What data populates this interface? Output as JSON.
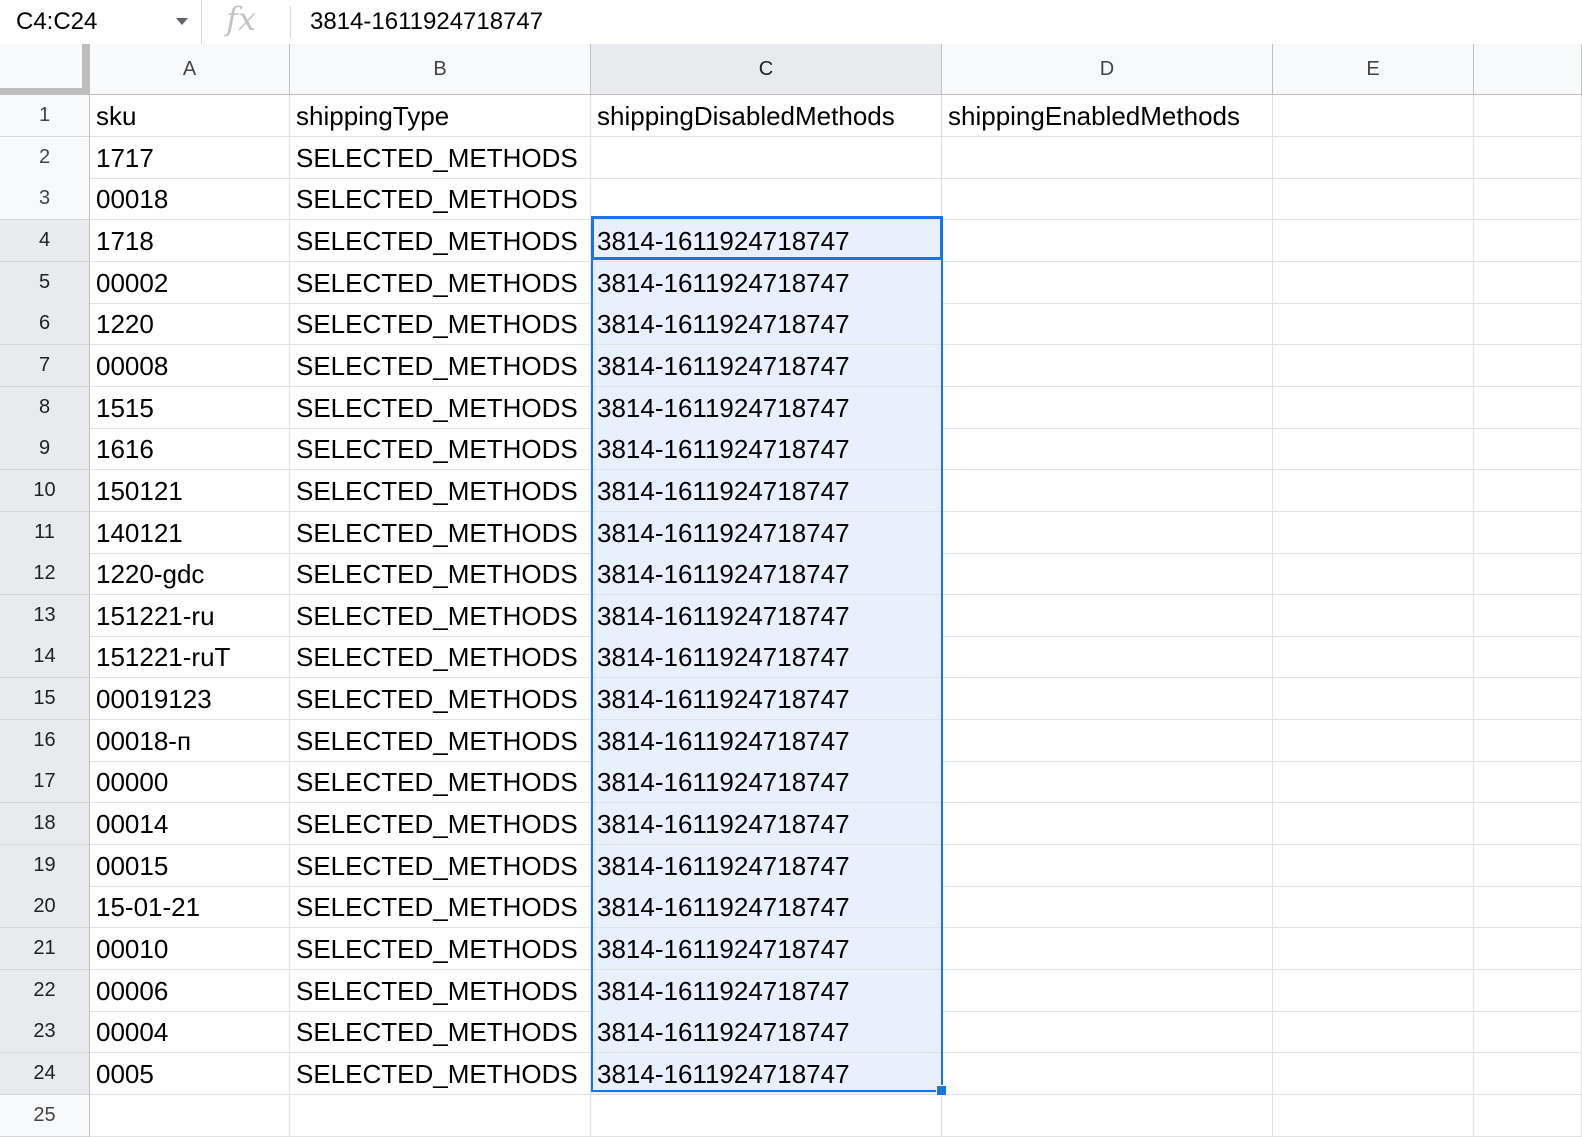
{
  "formula_bar": {
    "name_box": "C4:C24",
    "fx_icon": "fx-icon",
    "formula": "3814-1611924718747"
  },
  "columns": [
    "A",
    "B",
    "C",
    "D",
    "E"
  ],
  "selected_column": "C",
  "selected_range": "C4:C24",
  "colors": {
    "selection": "#1a73e8",
    "selection_fill": "#e8f0fe"
  },
  "rows": [
    {
      "n": "1",
      "cells": [
        "sku",
        "shippingType",
        "shippingDisabledMethods",
        "shippingEnabledMethods",
        ""
      ]
    },
    {
      "n": "2",
      "cells": [
        "1717",
        "SELECTED_METHODS",
        "",
        "",
        ""
      ]
    },
    {
      "n": "3",
      "cells": [
        "00018",
        "SELECTED_METHODS",
        "",
        "",
        ""
      ]
    },
    {
      "n": "4",
      "cells": [
        "1718",
        "SELECTED_METHODS",
        "3814-1611924718747",
        "",
        ""
      ]
    },
    {
      "n": "5",
      "cells": [
        "00002",
        "SELECTED_METHODS",
        "3814-1611924718747",
        "",
        ""
      ]
    },
    {
      "n": "6",
      "cells": [
        "1220",
        "SELECTED_METHODS",
        "3814-1611924718747",
        "",
        ""
      ]
    },
    {
      "n": "7",
      "cells": [
        "00008",
        "SELECTED_METHODS",
        "3814-1611924718747",
        "",
        ""
      ]
    },
    {
      "n": "8",
      "cells": [
        "1515",
        "SELECTED_METHODS",
        "3814-1611924718747",
        "",
        ""
      ]
    },
    {
      "n": "9",
      "cells": [
        "1616",
        "SELECTED_METHODS",
        "3814-1611924718747",
        "",
        ""
      ]
    },
    {
      "n": "10",
      "cells": [
        "150121",
        "SELECTED_METHODS",
        "3814-1611924718747",
        "",
        ""
      ]
    },
    {
      "n": "11",
      "cells": [
        "140121",
        "SELECTED_METHODS",
        "3814-1611924718747",
        "",
        ""
      ]
    },
    {
      "n": "12",
      "cells": [
        "1220-gdc",
        "SELECTED_METHODS",
        "3814-1611924718747",
        "",
        ""
      ]
    },
    {
      "n": "13",
      "cells": [
        "151221-ru",
        "SELECTED_METHODS",
        "3814-1611924718747",
        "",
        ""
      ]
    },
    {
      "n": "14",
      "cells": [
        "151221-ruT",
        "SELECTED_METHODS",
        "3814-1611924718747",
        "",
        ""
      ]
    },
    {
      "n": "15",
      "cells": [
        "00019123",
        "SELECTED_METHODS",
        "3814-1611924718747",
        "",
        ""
      ]
    },
    {
      "n": "16",
      "cells": [
        "00018-п",
        "SELECTED_METHODS",
        "3814-1611924718747",
        "",
        ""
      ]
    },
    {
      "n": "17",
      "cells": [
        "00000",
        "SELECTED_METHODS",
        "3814-1611924718747",
        "",
        ""
      ]
    },
    {
      "n": "18",
      "cells": [
        "00014",
        "SELECTED_METHODS",
        "3814-1611924718747",
        "",
        ""
      ]
    },
    {
      "n": "19",
      "cells": [
        "00015",
        "SELECTED_METHODS",
        "3814-1611924718747",
        "",
        ""
      ]
    },
    {
      "n": "20",
      "cells": [
        "15-01-21",
        "SELECTED_METHODS",
        "3814-1611924718747",
        "",
        ""
      ]
    },
    {
      "n": "21",
      "cells": [
        "00010",
        "SELECTED_METHODS",
        "3814-1611924718747",
        "",
        ""
      ]
    },
    {
      "n": "22",
      "cells": [
        "00006",
        "SELECTED_METHODS",
        "3814-1611924718747",
        "",
        ""
      ]
    },
    {
      "n": "23",
      "cells": [
        "00004",
        "SELECTED_METHODS",
        "3814-1611924718747",
        "",
        ""
      ]
    },
    {
      "n": "24",
      "cells": [
        "0005",
        "SELECTED_METHODS",
        "3814-1611924718747",
        "",
        ""
      ]
    },
    {
      "n": "25",
      "cells": [
        "",
        "",
        "",
        "",
        ""
      ]
    }
  ]
}
